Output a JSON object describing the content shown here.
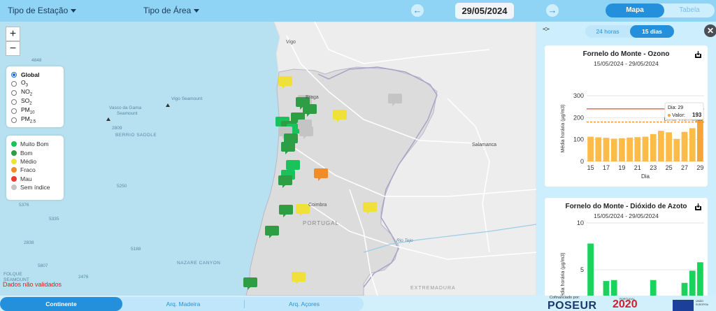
{
  "topbar": {
    "station_type": "Tipo de Estação",
    "area_type": "Tipo de Área",
    "date": "29/05/2024",
    "prev_icon": "arrow-left-icon",
    "next_icon": "arrow-right-icon",
    "view_map": "Mapa",
    "view_table": "Tabela"
  },
  "map": {
    "zoom_in": "+",
    "zoom_out": "−",
    "pollutants": [
      {
        "label": "Global",
        "sub": "",
        "selected": true
      },
      {
        "label": "O",
        "sub": "3",
        "selected": false
      },
      {
        "label": "NO",
        "sub": "2",
        "selected": false
      },
      {
        "label": "SO",
        "sub": "2",
        "selected": false
      },
      {
        "label": "PM",
        "sub": "10",
        "selected": false
      },
      {
        "label": "PM",
        "sub": "2.5",
        "selected": false
      }
    ],
    "legend": [
      {
        "label": "Muito Bom",
        "color": "#19c35b"
      },
      {
        "label": "Bom",
        "color": "#2e9e45"
      },
      {
        "label": "Médio",
        "color": "#efe03a"
      },
      {
        "label": "Fraco",
        "color": "#f08c2a"
      },
      {
        "label": "Mau",
        "color": "#ee3b32"
      },
      {
        "label": "Sem índice",
        "color": "#c4c4c4"
      }
    ],
    "place_labels": [
      "Vigo",
      "Braga",
      "Salamanca",
      "Coimbra",
      "PORTUGAL",
      "Rio Tejo",
      "EXTREMADURA"
    ],
    "sea_labels": [
      "Vasco da Gama",
      "Seamount",
      "Vigo Seamount",
      "BERRIO SADDLE",
      "NAZARE CANYON",
      "FOLQUE",
      "SEAMOUNT"
    ],
    "depth_labels": [
      "4848",
      "2809",
      "5250",
      "5376",
      "5335",
      "2838",
      "5188",
      "5807",
      "2476"
    ],
    "unvalidated": "Dados não validados"
  },
  "panel": {
    "range_24h": "24 horas",
    "range_15d": "15 dias",
    "close_icon": "close-icon",
    "collapse_icon": "chevrons-icon",
    "card1": {
      "title": "Fornelo do Monte - Ozono",
      "subtitle": "15/05/2024 - 29/05/2024",
      "tooltip_day": "Dia: 29",
      "tooltip_value_label": "Valor:",
      "tooltip_value": "193",
      "threshold_label": "Limiar informação"
    },
    "card2": {
      "title": "Fornelo do Monte - Dióxido de Azoto",
      "subtitle": "15/05/2024 - 29/05/2024"
    }
  },
  "chart_data": [
    {
      "type": "bar",
      "title": "Fornelo do Monte - Ozono",
      "subtitle": "15/05/2024 - 29/05/2024",
      "xlabel": "Dia",
      "ylabel": "Média horária (µg/m3)",
      "x": [
        15,
        16,
        17,
        18,
        19,
        20,
        21,
        22,
        23,
        24,
        25,
        26,
        27,
        28,
        29
      ],
      "x_tick_labels": [
        "15",
        "17",
        "19",
        "21",
        "23",
        "25",
        "27",
        "29"
      ],
      "values": [
        113,
        110,
        108,
        104,
        106,
        109,
        111,
        113,
        125,
        140,
        133,
        103,
        135,
        152,
        193
      ],
      "ylim": [
        0,
        300
      ],
      "y_ticks": [
        0,
        100,
        200,
        300
      ],
      "reference_lines": [
        {
          "value": 240,
          "color": "#e8302a",
          "style": "solid"
        },
        {
          "value": 180,
          "color": "#f08c2a",
          "style": "dashed",
          "label": "Limiar informação"
        }
      ],
      "bar_color": "#ffbb47",
      "highlight_color": "#f3a43a",
      "grid": true
    },
    {
      "type": "bar",
      "title": "Fornelo do Monte - Dióxido de Azoto",
      "subtitle": "15/05/2024 - 29/05/2024",
      "ylabel": "Média horária (µg/m3)",
      "x": [
        15,
        16,
        17,
        18,
        19,
        20,
        21,
        22,
        23,
        24,
        25,
        26,
        27,
        28,
        29
      ],
      "values": [
        7.8,
        0.4,
        3.8,
        3.9,
        0.2,
        0.2,
        0.2,
        0.8,
        3.9,
        1.0,
        1.0,
        0.3,
        3.6,
        4.9,
        5.8
      ],
      "ylim": [
        0,
        10
      ],
      "y_ticks": [
        5,
        10
      ],
      "bar_color": "#19d35c",
      "grid": true
    }
  ],
  "bottom": {
    "tabs": [
      "Continente",
      "Arq. Madeira",
      "Arq. Açores"
    ],
    "cofinanced": "Cofinanciado por:",
    "poseur": "POSEUR",
    "portugal2020": "2020",
    "portugal_small": "PORTUGAL",
    "eu_text": "UNIÃO EUROPEIA"
  }
}
